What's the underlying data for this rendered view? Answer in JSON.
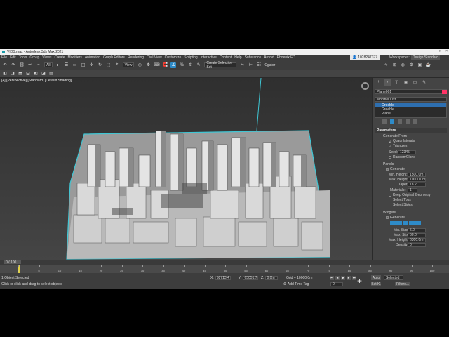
{
  "window": {
    "title": "VIDS.max - Autodesk 3ds Max 2021",
    "controls": [
      "–",
      "□",
      "×"
    ]
  },
  "menubar": {
    "items": [
      "File",
      "Edit",
      "Tools",
      "Group",
      "Views",
      "Create",
      "Modifiers",
      "Animation",
      "Graph Editors",
      "Rendering",
      "Civil View",
      "Customize",
      "Scripting",
      "Interactive",
      "Content",
      "Help",
      "Substance",
      "Arnold",
      "Phoenix FD"
    ],
    "user": "1028247377",
    "workspaces_label": "Workspaces:",
    "workspace": "Design Standard"
  },
  "toolbar": {
    "filter_value": "All",
    "refcoord_value": "View",
    "selection_set_placeholder": "Create Selection Set",
    "extra_label": "Cgator"
  },
  "viewport": {
    "label": "[+] [Perspective] [Standard] [Default Shading]"
  },
  "command_panel": {
    "object_name": "Plane001",
    "swatch_color": "#ff3366",
    "modifier_list_label": "Modifier List",
    "stack": [
      "Greeble",
      "Greeble",
      "Plane"
    ],
    "rollout_title": "Parameters",
    "generate_from_label": "Generate From",
    "quadrilaterals": "Quadrilaterals",
    "triangles": "Triangles",
    "seed_label": "Seed:",
    "seed_value": "12345",
    "random_clone": "RandomClone",
    "panels_label": "Panels",
    "generate": "Generate",
    "min_height_label": "Min. Height:",
    "min_height_value": "1500.0m",
    "max_height_label": "Max. Height:",
    "max_height_value": "10000.0m",
    "taper_label": "Taper:",
    "taper_value": "18.2",
    "materials_label": "Materials:",
    "materials_value": "1",
    "keep_original": "Keep Original Geometry",
    "select_tops": "Select Tops",
    "select_sides": "Select Sides",
    "widgets_label": "Widgets",
    "widgets_generate": "Generate",
    "min_size_label": "Min. Size:",
    "min_size_value": "5.0",
    "max_size_label": "Max. Size:",
    "max_size_value": "50.0",
    "w_max_height_label": "Max. Height:",
    "w_max_height_value": "6300.0m",
    "density_label": "Density:",
    "density_value": "0",
    "accent": "#2e8bc8"
  },
  "timeline": {
    "slider": "0 / 100",
    "ticks": [
      "0",
      "5",
      "10",
      "15",
      "20",
      "25",
      "30",
      "35",
      "40",
      "45",
      "50",
      "55",
      "60",
      "65",
      "70",
      "75",
      "80",
      "85",
      "90",
      "95",
      "100"
    ]
  },
  "status": {
    "selected": "1 Object Selected",
    "prompt": "Click or click-and-drag to select objects",
    "x_label": "X:",
    "x_value": "58713.4",
    "y_label": "Y:",
    "y_value": "65051.7",
    "z_label": "Z:",
    "z_value": "0.0m",
    "grid": "Grid = 10000.0m",
    "add_time_tag": "Add Time Tag",
    "frame_value": "0",
    "auto": "Auto",
    "set_key": "Set K.",
    "selected_dropdown": "Selected",
    "filters": "Filters..."
  }
}
